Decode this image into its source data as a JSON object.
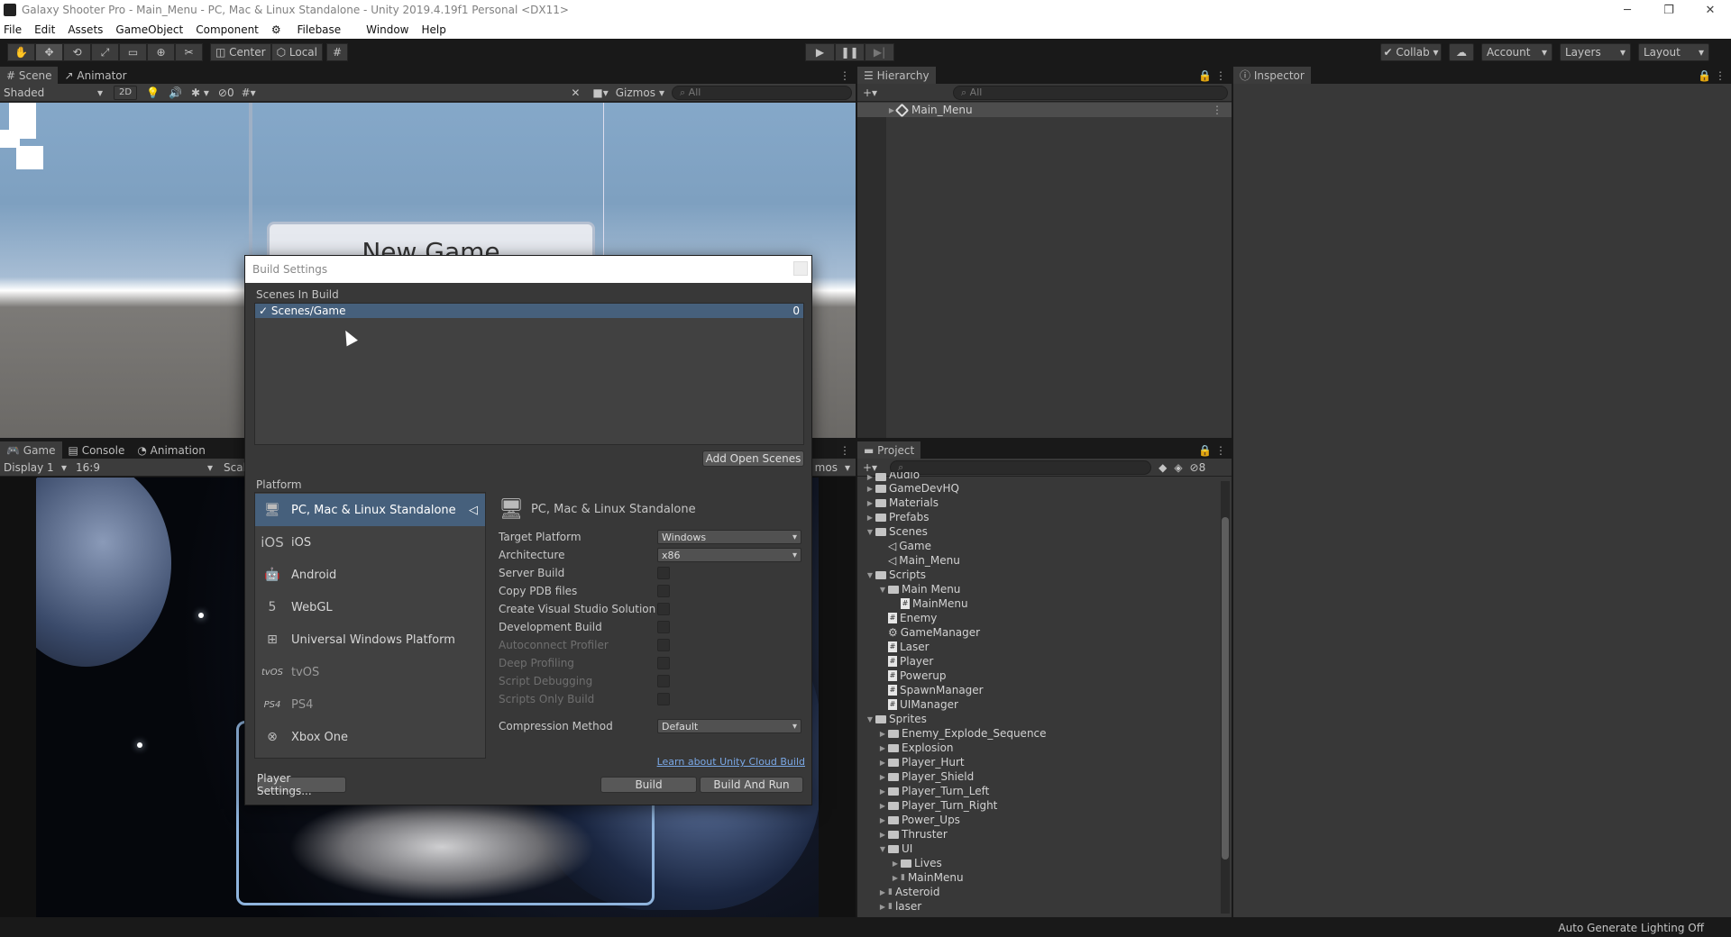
{
  "window": {
    "title": "Galaxy Shooter Pro - Main_Menu - PC, Mac & Linux Standalone - Unity 2019.4.19f1 Personal <DX11>"
  },
  "menu": [
    "File",
    "Edit",
    "Assets",
    "GameObject",
    "Component",
    "Filebase",
    "Window",
    "Help"
  ],
  "toolbar": {
    "center": "Center",
    "local": "Local",
    "collab": "Collab",
    "account": "Account",
    "layers": "Layers",
    "layout": "Layout"
  },
  "scene_panel": {
    "tabs": [
      "Scene",
      "Animator"
    ],
    "shading": "Shaded",
    "mode_2d": "2D",
    "hidden_count": "0",
    "gizmos": "Gizmos",
    "search_placeholder": "All",
    "new_game_text": "New Game"
  },
  "game_panel": {
    "tabs": [
      "Game",
      "Console",
      "Animation"
    ],
    "display": "Display 1",
    "aspect": "16:9",
    "scale": "Scal",
    "gizmos_partial": "mos"
  },
  "hierarchy": {
    "title": "Hierarchy",
    "search_placeholder": "All",
    "scene": "Main_Menu"
  },
  "inspector": {
    "title": "Inspector"
  },
  "project": {
    "title": "Project",
    "hidden_count": "8",
    "items": [
      {
        "label": "Audio",
        "depth": 1,
        "type": "folder"
      },
      {
        "label": "GameDevHQ",
        "depth": 1,
        "type": "folder"
      },
      {
        "label": "Materials",
        "depth": 1,
        "type": "folder"
      },
      {
        "label": "Prefabs",
        "depth": 1,
        "type": "folder"
      },
      {
        "label": "Scenes",
        "depth": 1,
        "type": "folder-open"
      },
      {
        "label": "Game",
        "depth": 2,
        "type": "scene"
      },
      {
        "label": "Main_Menu",
        "depth": 2,
        "type": "scene"
      },
      {
        "label": "Scripts",
        "depth": 1,
        "type": "folder-open"
      },
      {
        "label": "Main Menu",
        "depth": 2,
        "type": "folder-open"
      },
      {
        "label": "MainMenu",
        "depth": 3,
        "type": "script"
      },
      {
        "label": "Enemy",
        "depth": 2,
        "type": "script"
      },
      {
        "label": "GameManager",
        "depth": 2,
        "type": "gear"
      },
      {
        "label": "Laser",
        "depth": 2,
        "type": "script"
      },
      {
        "label": "Player",
        "depth": 2,
        "type": "script"
      },
      {
        "label": "Powerup",
        "depth": 2,
        "type": "script"
      },
      {
        "label": "SpawnManager",
        "depth": 2,
        "type": "script"
      },
      {
        "label": "UIManager",
        "depth": 2,
        "type": "script"
      },
      {
        "label": "Sprites",
        "depth": 1,
        "type": "folder-open"
      },
      {
        "label": "Enemy_Explode_Sequence",
        "depth": 2,
        "type": "folder"
      },
      {
        "label": "Explosion",
        "depth": 2,
        "type": "folder"
      },
      {
        "label": "Player_Hurt",
        "depth": 2,
        "type": "folder"
      },
      {
        "label": "Player_Shield",
        "depth": 2,
        "type": "folder"
      },
      {
        "label": "Player_Turn_Left",
        "depth": 2,
        "type": "folder"
      },
      {
        "label": "Player_Turn_Right",
        "depth": 2,
        "type": "folder"
      },
      {
        "label": "Power_Ups",
        "depth": 2,
        "type": "folder"
      },
      {
        "label": "Thruster",
        "depth": 2,
        "type": "folder"
      },
      {
        "label": "UI",
        "depth": 2,
        "type": "folder-open"
      },
      {
        "label": "Lives",
        "depth": 3,
        "type": "folder"
      },
      {
        "label": "MainMenu",
        "depth": 3,
        "type": "sprite"
      },
      {
        "label": "Asteroid",
        "depth": 2,
        "type": "sprite"
      },
      {
        "label": "laser",
        "depth": 2,
        "type": "sprite"
      }
    ]
  },
  "build_settings": {
    "title": "Build Settings",
    "scenes_header": "Scenes In Build",
    "scenes": [
      {
        "name": "Scenes/Game",
        "index": "0",
        "checked": true
      }
    ],
    "add_open_scenes": "Add Open Scenes",
    "platform_header": "Platform",
    "platforms": [
      {
        "name": "PC, Mac & Linux Standalone",
        "icon": "monitor-icon",
        "selected": true
      },
      {
        "name": "iOS",
        "icon": "ios-icon"
      },
      {
        "name": "Android",
        "icon": "android-icon"
      },
      {
        "name": "WebGL",
        "icon": "html5-icon"
      },
      {
        "name": "Universal Windows Platform",
        "icon": "windows-icon"
      },
      {
        "name": "tvOS",
        "icon": "tvos-icon"
      },
      {
        "name": "PS4",
        "icon": "ps4-icon"
      },
      {
        "name": "Xbox One",
        "icon": "xbox-icon"
      }
    ],
    "settings_title": "PC, Mac & Linux Standalone",
    "options": {
      "target_platform": {
        "label": "Target Platform",
        "value": "Windows"
      },
      "architecture": {
        "label": "Architecture",
        "value": "x86"
      },
      "server_build": "Server Build",
      "copy_pdb": "Copy PDB files",
      "create_vs": "Create Visual Studio Solution",
      "development_build": "Development Build",
      "autoconnect_profiler": "Autoconnect Profiler",
      "deep_profiling": "Deep Profiling",
      "script_debugging": "Script Debugging",
      "scripts_only": "Scripts Only Build",
      "compression": {
        "label": "Compression Method",
        "value": "Default"
      }
    },
    "cloud_build_link": "Learn about Unity Cloud Build",
    "player_settings": "Player Settings...",
    "build": "Build",
    "build_and_run": "Build And Run"
  },
  "status": {
    "lighting": "Auto Generate Lighting Off"
  }
}
